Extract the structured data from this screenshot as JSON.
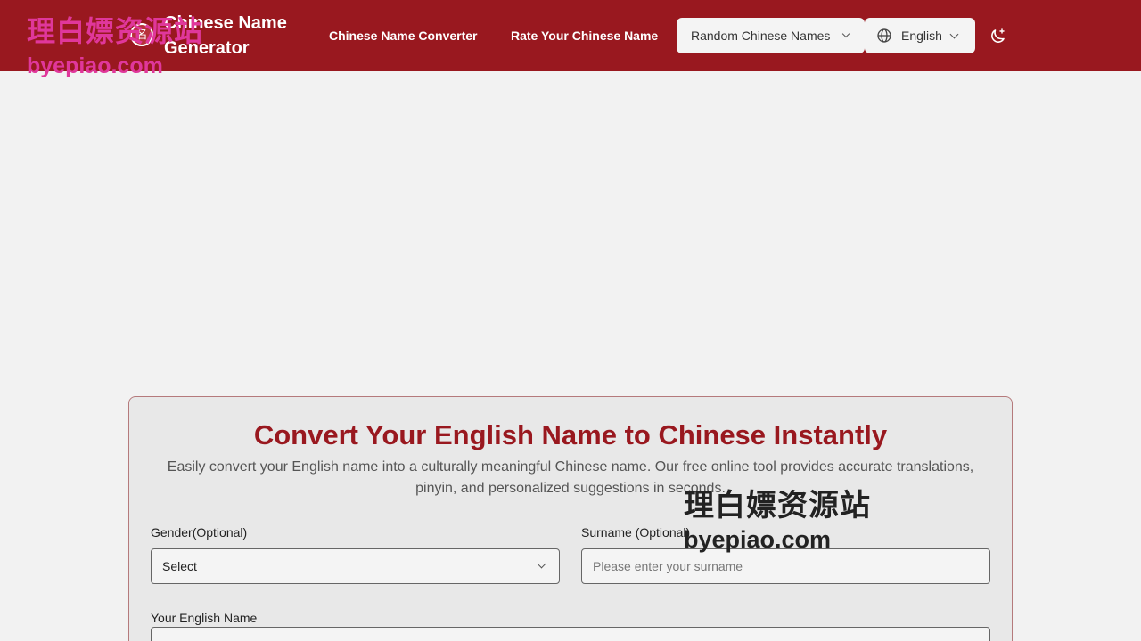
{
  "header": {
    "brand_line1": "Chinese Name",
    "brand_line2": "Generator",
    "logo_glyph": "名",
    "nav_converter": "Chinese Name Converter",
    "nav_rate": "Rate Your Chinese Name",
    "random_label": "Random Chinese Names",
    "language_label": "English"
  },
  "watermark": {
    "cn": "理白嫖资源站",
    "en": "byepiao.com"
  },
  "card": {
    "title": "Convert Your English Name to Chinese Instantly",
    "description": "Easily convert your English name into a culturally meaningful Chinese name. Our free online tool provides accurate translations, pinyin, and personalized suggestions in seconds.",
    "gender_label": "Gender(Optional)",
    "gender_value": "Select",
    "surname_label": "Surname (Optional)",
    "surname_placeholder": "Please enter your surname",
    "english_label": "Your English Name"
  },
  "colors": {
    "brand": "#99181f",
    "background": "#f2f2f2",
    "watermark_pink": "#e0379b"
  },
  "icons": [
    "logo-icon",
    "globe-icon",
    "chevron-down-icon",
    "moon-icon"
  ]
}
